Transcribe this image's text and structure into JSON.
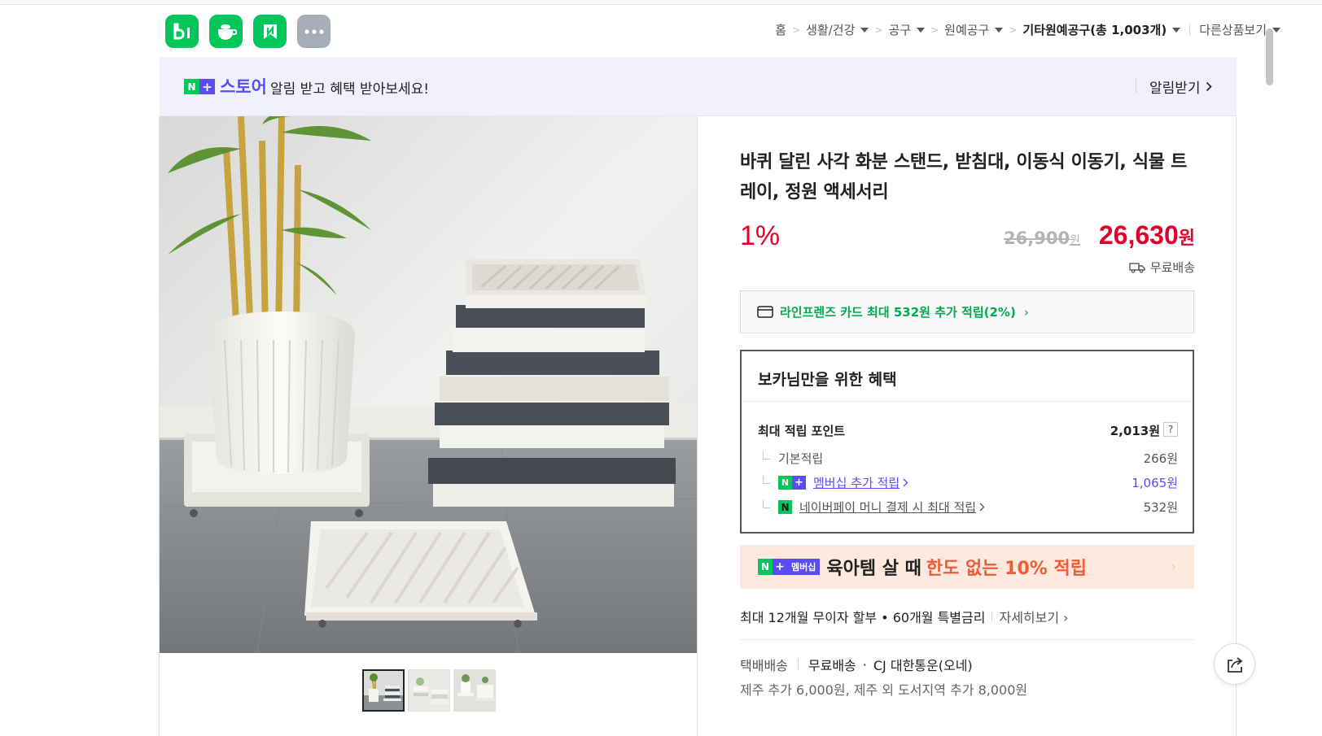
{
  "header": {
    "app_icons": [
      {
        "name": "blog-icon",
        "glyph": "b|",
        "color": "#03c75a"
      },
      {
        "name": "cafe-icon",
        "glyph": "cup",
        "color": "#03c75a"
      },
      {
        "name": "smartstore-icon",
        "glyph": "N",
        "color": "#03c75a"
      },
      {
        "name": "more-services-icon",
        "glyph": "···",
        "color": "#a7adb8"
      }
    ],
    "breadcrumb": {
      "home": "홈",
      "cat1": "생활/건강",
      "cat2": "공구",
      "cat3": "원예공구",
      "cat4": "기타원예공구(총 1,003개)",
      "other": "다른상품보기"
    }
  },
  "notify_banner": {
    "logo_n": "N",
    "logo_plus": "+",
    "store_label": "스토어",
    "message": "알림 받고 혜택 받아보세요!",
    "button_label": "알림받기"
  },
  "product": {
    "title": "바퀴 달린 사각 화분 스탠드, 받침대, 이동식 이동기, 식물 트레이, 정원 액세서리",
    "discount_rate": "1%",
    "original_price": "26,900",
    "original_price_unit": "원",
    "sale_price": "26,630",
    "sale_price_unit": "원",
    "shipping_badge": "무료배송",
    "thumbnail_count": 3,
    "selected_thumbnail": 1
  },
  "card_offer": {
    "text": "라인프렌즈 카드 최대 532원 추가 적립(2%)",
    "chevron": "›"
  },
  "benefits": {
    "title": "보카님만을 위한 혜택",
    "max_points_label": "최대 적립 포인트",
    "max_points_value": "2,013원",
    "help": "?",
    "rows": [
      {
        "label": "기본적립",
        "value": "266원"
      },
      {
        "label": "멤버십 추가 적립",
        "value": "1,065원"
      },
      {
        "label": "네이버페이 머니 결제 시 최대 적립",
        "value": "532원"
      }
    ]
  },
  "promo": {
    "badge_n": "N",
    "badge_plus": "+",
    "badge_membership": "멤버십",
    "text": "육아템 살 때",
    "highlight": "한도 없는 10% 적립",
    "chevron": "›"
  },
  "installment": {
    "text": "최대 12개월 무이자 할부 • 60개월 특별금리",
    "more": "자세히보기"
  },
  "delivery": {
    "method": "택배배송",
    "fee": "무료배송",
    "courier": "CJ 대한통운(오네)",
    "note": "제주 추가 6,000원, 제주 외 도서지역 추가 8,000원"
  },
  "colors": {
    "naver_green": "#03c75a",
    "price_red": "#e4002b",
    "plus_purple": "#5b4cf5",
    "promo_orange": "#f15b3a"
  }
}
